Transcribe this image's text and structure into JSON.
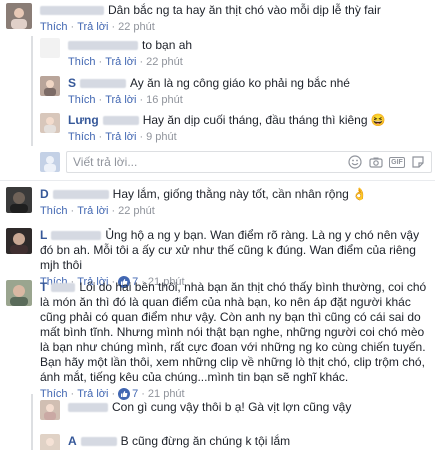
{
  "actions": {
    "like": "Thích",
    "reply": "Trả lời",
    "separator": "·"
  },
  "reply_box": {
    "placeholder": "Viết trả lời..."
  },
  "comments": [
    {
      "name_visible": "",
      "text": "Dân bắc ng ta hay ăn thịt chó vào mỗi dịp lễ thỳ fair",
      "time": "22 phút"
    },
    {
      "name_visible": "",
      "text": "to bạn ah",
      "time": "22 phút"
    },
    {
      "name_visible": "S",
      "text": "Ay ăn là ng công giáo ko phải ng bắc nhé",
      "time": "16 phút"
    },
    {
      "name_visible": "Lưng",
      "text": "Hay ăn dịp cuối tháng, đầu tháng thì kiêng",
      "emoji": "😆",
      "time": "9 phút"
    },
    {
      "name_visible": "D",
      "text": "Hay lắm, giống thằng này tốt, cần nhân rộng",
      "emoji": "👌",
      "time": "22 phút"
    },
    {
      "name_visible": "L",
      "text": "Ủng hộ a ng y bạn. Wan điểm rõ ràng. Là ng y chó nên vậy đó bn ah. Mỗi tôi a ấy cư xử như thế cũng k đúng. Wan điểm của riêng mjh thôi",
      "likes": "7",
      "time": "21 phút"
    },
    {
      "name_visible": "T",
      "text": "Lối do hai bên thôi, nhà bạn ăn thịt chó thấy bình thường, coi chó là món ăn thì đó là quan điểm của nhà bạn, ko nên áp đặt người khác cũng phải có quan điểm như vậy. Còn anh ny bạn thì cũng có cái sai do mất bình tĩnh. Nhưng mình nói thật bạn nghe, những người coi chó mèo là bạn như chúng mình, rất cực đoan với những ng ko cùng chiến tuyến. Bạn hãy một lần thôi, xem những clip về những lò thịt chó, clip trộm chó, ánh mắt, tiếng kêu của chúng...mình tin bạn sẽ nghĩ khác.",
      "likes": "7",
      "time": "21 phút"
    },
    {
      "name_visible": "",
      "text": "Con gì cung vậy thôi b ạ! Gà vịt lợn cũng vậy",
      "time": ""
    },
    {
      "name_visible": "A",
      "text": "B cũng đừng ăn chúng k tội lắm",
      "time": ""
    }
  ],
  "colors": {
    "link": "#365899",
    "action": "#4267b2",
    "meta": "#90949c",
    "text": "#1d2129",
    "border": "#dddfe2"
  }
}
